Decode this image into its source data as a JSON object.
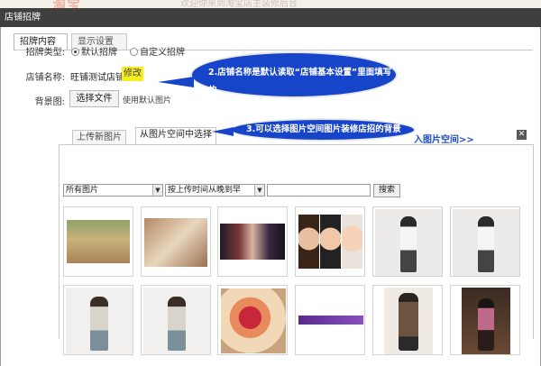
{
  "window": {
    "title": "店铺招牌"
  },
  "tabs": [
    {
      "label": "招牌内容",
      "active": true
    },
    {
      "label": "显示设置",
      "active": false
    }
  ],
  "form": {
    "type_label": "招牌类型:",
    "type_options": [
      {
        "label": "默认招牌",
        "checked": true
      },
      {
        "label": "自定义招牌",
        "checked": false
      }
    ],
    "shop_name_label": "店铺名称:",
    "shop_name_value": "旺铺测试店铺",
    "modify_label": "修改",
    "background_label": "背景图:",
    "choose_file_label": "选择文件",
    "use_default_label": "使用默认图片"
  },
  "callouts": {
    "shop_name_line1": "2.店铺名称是默认读取“店铺基本设置”里面填写的",
    "shop_name_line2": "也可以点击“修改”进行手动修改",
    "image_space": "3.可以选择图片空间图片装修店招的背景"
  },
  "image_tabs": [
    {
      "label": "上传新图片",
      "active": false
    },
    {
      "label": "从图片空间中选择",
      "active": true
    }
  ],
  "enter_space_label": "入图片空间>>",
  "close_label": "✕",
  "filters": {
    "category": "所有图片",
    "sort": "按上传时间从晚到早",
    "search_label": "搜索",
    "search_value": ""
  },
  "thumbnails": [
    {
      "name": "house-photo"
    },
    {
      "name": "vintage-room-photo"
    },
    {
      "name": "dark-banner-photo"
    },
    {
      "name": "faces-photo"
    },
    {
      "name": "woman-white-top-photo"
    },
    {
      "name": "woman-white-top-photo-2"
    },
    {
      "name": "woman-striped-photo"
    },
    {
      "name": "woman-striped-photo-2"
    },
    {
      "name": "floral-painting-photo"
    },
    {
      "name": "purple-banner-photo"
    },
    {
      "name": "woman-coat-photo"
    },
    {
      "name": "woman-dark-room-photo"
    }
  ],
  "colors": {
    "titlebar": "#3f3f3f",
    "callout": "#1745c9",
    "highlight": "#f6ee1d",
    "link": "#1c4fbf"
  }
}
